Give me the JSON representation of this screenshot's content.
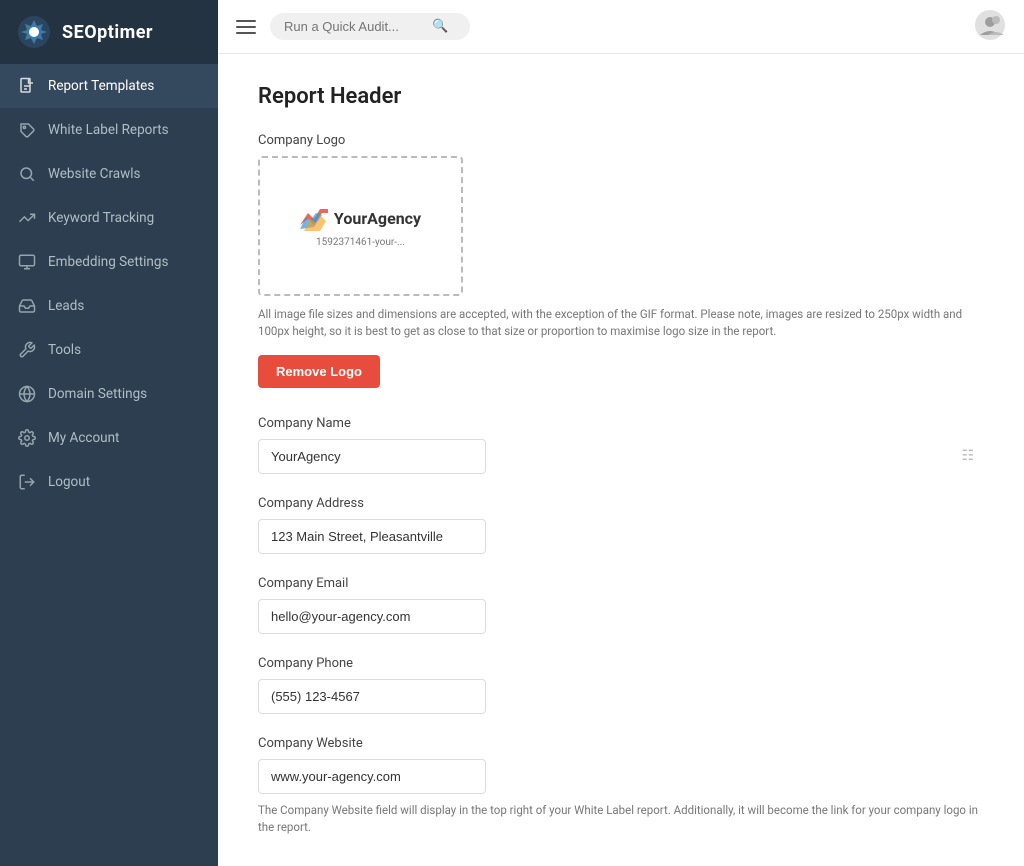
{
  "brand": {
    "name": "SEOptimer"
  },
  "sidebar": {
    "items": [
      {
        "id": "report-templates",
        "label": "Report Templates",
        "icon": "file-icon",
        "active": true
      },
      {
        "id": "white-label-reports",
        "label": "White Label Reports",
        "icon": "tag-icon",
        "active": false
      },
      {
        "id": "website-crawls",
        "label": "Website Crawls",
        "icon": "search-icon",
        "active": false
      },
      {
        "id": "keyword-tracking",
        "label": "Keyword Tracking",
        "icon": "trending-icon",
        "active": false
      },
      {
        "id": "embedding-settings",
        "label": "Embedding Settings",
        "icon": "monitor-icon",
        "active": false
      },
      {
        "id": "leads",
        "label": "Leads",
        "icon": "inbox-icon",
        "active": false
      },
      {
        "id": "tools",
        "label": "Tools",
        "icon": "wrench-icon",
        "active": false
      },
      {
        "id": "domain-settings",
        "label": "Domain Settings",
        "icon": "globe-icon",
        "active": false
      },
      {
        "id": "my-account",
        "label": "My Account",
        "icon": "gear-icon",
        "active": false
      },
      {
        "id": "logout",
        "label": "Logout",
        "icon": "logout-icon",
        "active": false
      }
    ]
  },
  "topbar": {
    "search_placeholder": "Run a Quick Audit..."
  },
  "main": {
    "page_title": "Report Header",
    "company_logo": {
      "label": "Company Logo",
      "agency_name": "YourAgency",
      "filename": "1592371461-your-...",
      "note": "All image file sizes and dimensions are accepted, with the exception of the GIF format. Please note, images are resized to 250px width and 100px height, so it is best to get as close to that size or proportion to maximise logo size in the report.",
      "remove_button": "Remove Logo"
    },
    "company_name": {
      "label": "Company Name",
      "value": "YourAgency",
      "placeholder": "YourAgency"
    },
    "company_address": {
      "label": "Company Address",
      "value": "123 Main Street, Pleasantville",
      "placeholder": "123 Main Street, Pleasantville"
    },
    "company_email": {
      "label": "Company Email",
      "value": "hello@your-agency.com",
      "placeholder": "hello@your-agency.com"
    },
    "company_phone": {
      "label": "Company Phone",
      "value": "(555) 123-4567",
      "placeholder": "(555) 123-4567"
    },
    "company_website": {
      "label": "Company Website",
      "value": "www.your-agency.com",
      "placeholder": "www.your-agency.com",
      "note": "The Company Website field will display in the top right of your White Label report. Additionally, it will become the link for your company logo in the report."
    }
  }
}
